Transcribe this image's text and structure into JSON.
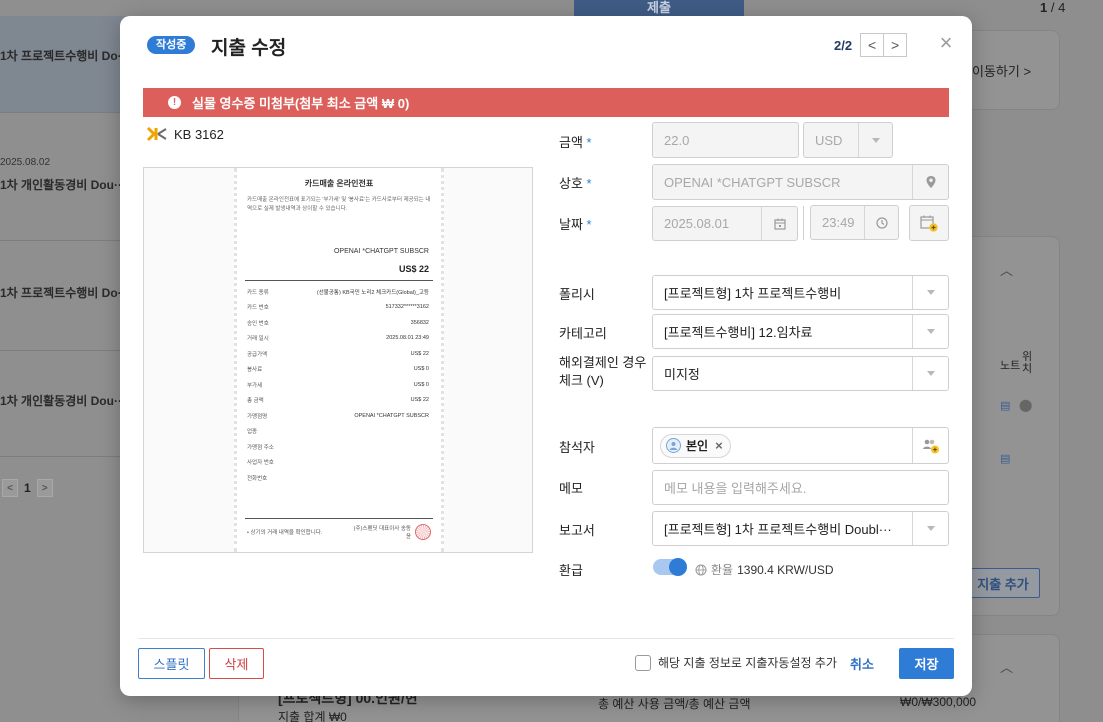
{
  "background": {
    "left_rows": [
      {
        "title": "1차 프로젝트수행비 Do···",
        "date": ""
      },
      {
        "title": "1차 개인활동경비 Dou···",
        "date": "2025.08.02"
      },
      {
        "title": "1차 프로젝트수행비 Do···",
        "date": ""
      },
      {
        "title": "1차 개인활동경비 Dou···",
        "date": ""
      }
    ],
    "left_pager": {
      "prev": "<",
      "page": "1",
      "next": ">"
    },
    "submit_button": "제출",
    "top_pager": {
      "current": "1",
      "total": "/ 4"
    },
    "move_link": "이동하기 >",
    "note_col": "노트",
    "loc_col": "위\n치",
    "add_expense_button": "지출 추가",
    "bottom_title": "[프로젝트형] 00.인원/현",
    "bottom_total": "지출 합계 ₩0",
    "bottom_budget_label": "총 예산 사용 금액/총 예산 금액",
    "bottom_budget_value": "₩0/₩300,000"
  },
  "modal": {
    "status_badge": "작성중",
    "title": "지출 수정",
    "pager_text": "2/2",
    "pager_prev": "<",
    "pager_next": ">",
    "close": "×",
    "alert_icon": "!",
    "alert_text": "실물 영수증 미첨부(첨부 최소 금액 ₩ 0)",
    "card_label": "KB 3162",
    "receipt": {
      "title": "카드매출 온라인전표",
      "desc": "카드매출 온라인전표에 표기되는 '부가세' 및 '봉사료'는 카드사로부터 제공되는 내역으로 실제 발생내역과 상이할 수 있습니다.",
      "merchant": "OPENAI *CHATGPT SUBSCR",
      "amount": "US$ 22",
      "rows": [
        {
          "k": "카드 종류",
          "v": "(선불공통) KB국민 노리2 체크카드(Global)_고등"
        },
        {
          "k": "카드 번호",
          "v": "517332******3162"
        },
        {
          "k": "승인 번호",
          "v": "356832"
        },
        {
          "k": "거래 일시",
          "v": "2025.08.01 23:49"
        },
        {
          "k": "공급가액",
          "v": "US$ 22"
        },
        {
          "k": "봉사료",
          "v": "US$ 0"
        },
        {
          "k": "부가세",
          "v": "US$ 0"
        },
        {
          "k": "총 금액",
          "v": "US$ 22"
        },
        {
          "k": "가맹점명",
          "v": "OPENAI *CHATGPT SUBSCR"
        },
        {
          "k": "업종",
          "v": ""
        },
        {
          "k": "가맹점 주소",
          "v": ""
        },
        {
          "k": "사업자 번호",
          "v": ""
        },
        {
          "k": "전화번호",
          "v": ""
        }
      ],
      "footer_left": "• 상기의 거래 내역을 확인합니다.",
      "footer_right": "(주)스펜딧 대표이사 송동윤"
    },
    "fields": {
      "amount_label": "금액",
      "amount_value": "22.0",
      "currency_value": "USD",
      "merchant_label": "상호",
      "merchant_value": "OPENAI *CHATGPT SUBSCR",
      "date_label": "날짜",
      "date_value": "2025.08.01",
      "time_value": "23:49",
      "policy_label": "폴리시",
      "policy_value": "[프로젝트형] 1차 프로젝트수행비",
      "category_label": "카테고리",
      "category_value": "[프로젝트수행비] 12.임차료",
      "overseas_label_1": "해외결제인 경우",
      "overseas_label_2": "체크 (V)",
      "overseas_value": "미지정",
      "attendee_label": "참석자",
      "attendee_chip": "본인",
      "attendee_remove": "×",
      "memo_label": "메모",
      "memo_placeholder": "메모 내용을 입력해주세요.",
      "report_label": "보고서",
      "report_value": "[프로젝트형] 1차 프로젝트수행비 Doubl···",
      "refund_label": "환급",
      "exchange_rate_label": "환율",
      "exchange_rate_value": "1390.4 KRW/USD",
      "required_mark": "*"
    },
    "footer": {
      "split_button": "스플릿",
      "delete_button": "삭제",
      "auto_setting_checkbox_label": "해당 지출 정보로 지출자동설정 추가",
      "auto_setting_checked": false,
      "cancel_button": "취소",
      "save_button": "저장"
    },
    "refund_toggle_on": true
  },
  "colors": {
    "primary": "#2f7cd6",
    "alert": "#dc5f5b",
    "danger": "#d13f3f"
  }
}
